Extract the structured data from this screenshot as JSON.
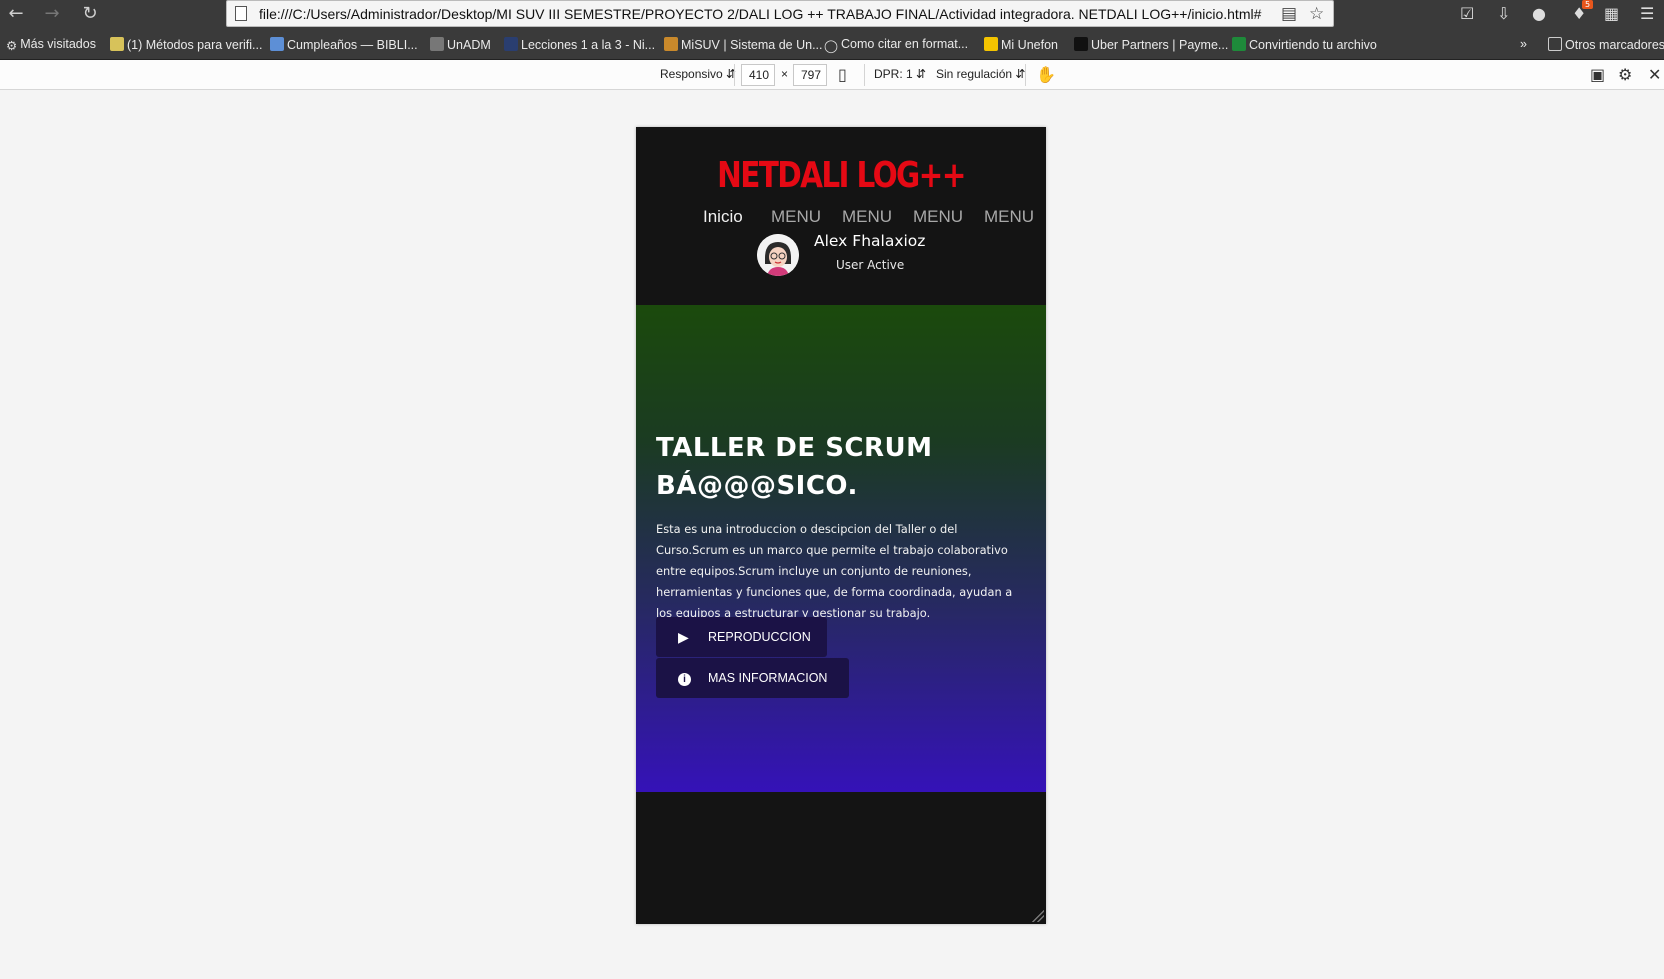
{
  "browser": {
    "url": "file:///C:/Users/Administrador/Desktop/MI SUV III SEMESTRE/PROYECTO 2/DALI LOG ++ TRABAJO FINAL/Actividad integradora. NETDALI LOG++/inicio.html#",
    "notification_count": "5"
  },
  "bookmarks": [
    {
      "label": "Más visitados",
      "icon": "gear-icon"
    },
    {
      "label": "(1) Métodos para verifi...",
      "icon": "site-icon"
    },
    {
      "label": "Cumpleaños — BIBLI...",
      "icon": "site-icon"
    },
    {
      "label": "UnADM",
      "icon": "site-icon"
    },
    {
      "label": "Lecciones 1 a la 3 - Ni...",
      "icon": "site-icon"
    },
    {
      "label": "MiSUV | Sistema de Un...",
      "icon": "site-icon"
    },
    {
      "label": "Como citar en format...",
      "icon": "globe-icon"
    },
    {
      "label": "Mi Unefon",
      "icon": "site-icon"
    },
    {
      "label": "Uber Partners | Payme...",
      "icon": "site-icon"
    },
    {
      "label": "Convirtiendo tu archivo",
      "icon": "site-icon"
    }
  ],
  "bookmarks_other": "Otros marcadores",
  "responsive_toolbar": {
    "device": "Responsivo",
    "width": "410",
    "times": "×",
    "height": "797",
    "dpr": "DPR: 1",
    "throttling": "Sin regulación"
  },
  "site": {
    "logo": "NETDALI LOG++",
    "nav": [
      "Inicio",
      "MENU",
      "MENU",
      "MENU",
      "MENU"
    ],
    "user_name": "Alex Fhalaxioz",
    "user_status": "User Active",
    "hero_title": "TALLER DE SCRUM BÁ@@@SICO.",
    "hero_text": "Esta es una introduccion o descipcion del Taller o del Curso.Scrum es un marco que permite el trabajo colaborativo entre equipos.Scrum incluye un conjunto de reuniones, herramientas y funciones que, de forma coordinada, ayudan a los equipos a estructurar y gestionar su trabajo.",
    "btn_play": "REPRODUCCION",
    "btn_info": "MAS INFORMACION"
  },
  "colors": {
    "logo": "#e50914",
    "hero_top": "#1b4a0c",
    "hero_bottom": "#3512b8",
    "button_bg": "#1b1246",
    "site_bg": "#141414"
  }
}
